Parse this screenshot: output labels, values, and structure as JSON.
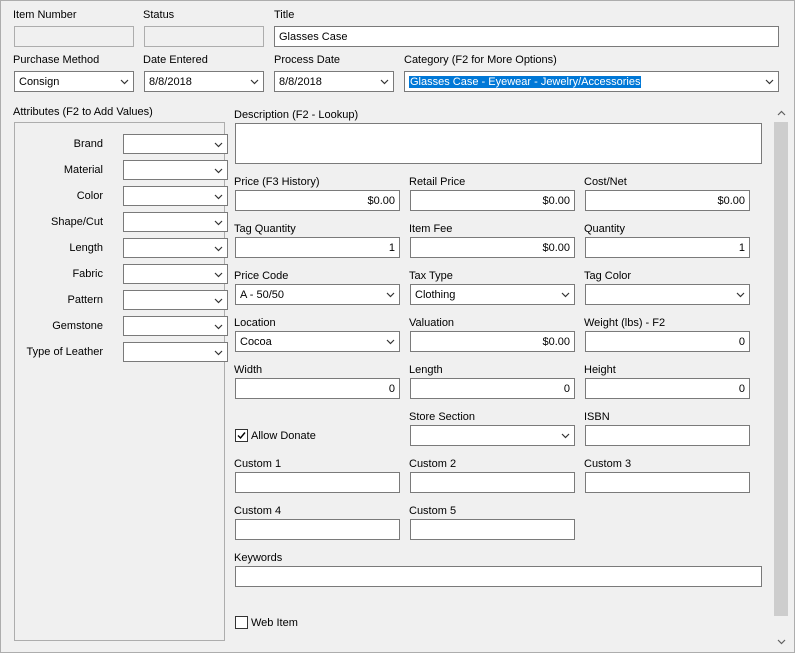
{
  "header": {
    "item_number": {
      "label": "Item Number",
      "value": ""
    },
    "status": {
      "label": "Status",
      "value": ""
    },
    "title": {
      "label": "Title",
      "value": "Glasses Case"
    },
    "purchase_method": {
      "label": "Purchase Method",
      "value": "Consign"
    },
    "date_entered": {
      "label": "Date Entered",
      "value": "8/8/2018"
    },
    "process_date": {
      "label": "Process Date",
      "value": "8/8/2018"
    },
    "category": {
      "label": "Category (F2 for More Options)",
      "value": "Glasses Case - Eyewear - Jewelry/Accessories"
    }
  },
  "attributes": {
    "title": "Attributes (F2 to Add Values)",
    "items": [
      {
        "label": "Brand",
        "value": ""
      },
      {
        "label": "Material",
        "value": ""
      },
      {
        "label": "Color",
        "value": ""
      },
      {
        "label": "Shape/Cut",
        "value": ""
      },
      {
        "label": "Length",
        "value": ""
      },
      {
        "label": "Fabric",
        "value": ""
      },
      {
        "label": "Pattern",
        "value": ""
      },
      {
        "label": "Gemstone",
        "value": ""
      },
      {
        "label": "Type of Leather",
        "value": ""
      }
    ]
  },
  "details": {
    "description": {
      "label": "Description (F2 - Lookup)",
      "value": ""
    },
    "price": {
      "label": "Price (F3 History)",
      "value": "$0.00"
    },
    "retail_price": {
      "label": "Retail Price",
      "value": "$0.00"
    },
    "cost_net": {
      "label": "Cost/Net",
      "value": "$0.00"
    },
    "tag_quantity": {
      "label": "Tag Quantity",
      "value": "1"
    },
    "item_fee": {
      "label": "Item Fee",
      "value": "$0.00"
    },
    "quantity": {
      "label": "Quantity",
      "value": "1"
    },
    "price_code": {
      "label": "Price Code",
      "value": "A - 50/50"
    },
    "tax_type": {
      "label": "Tax Type",
      "value": "Clothing"
    },
    "tag_color": {
      "label": "Tag Color",
      "value": ""
    },
    "location": {
      "label": "Location",
      "value": "Cocoa"
    },
    "valuation": {
      "label": "Valuation",
      "value": "$0.00"
    },
    "weight": {
      "label": "Weight (lbs) - F2",
      "value": "0"
    },
    "width": {
      "label": "Width",
      "value": "0"
    },
    "length": {
      "label": "Length",
      "value": "0"
    },
    "height": {
      "label": "Height",
      "value": "0"
    },
    "allow_donate": {
      "label": "Allow Donate",
      "checked": true
    },
    "store_section": {
      "label": "Store Section",
      "value": ""
    },
    "isbn": {
      "label": "ISBN",
      "value": ""
    },
    "custom1": {
      "label": "Custom 1",
      "value": ""
    },
    "custom2": {
      "label": "Custom 2",
      "value": ""
    },
    "custom3": {
      "label": "Custom 3",
      "value": ""
    },
    "custom4": {
      "label": "Custom 4",
      "value": ""
    },
    "custom5": {
      "label": "Custom 5",
      "value": ""
    },
    "keywords": {
      "label": "Keywords",
      "value": ""
    },
    "web_item": {
      "label": "Web Item",
      "checked": false
    }
  },
  "colors": {
    "window_bg": "#f0f0f0",
    "selection": "#0078d7",
    "field_border": "#7a7a7a",
    "scroll_thumb": "#cdcdcd"
  },
  "icons": [
    "chevron-down-icon",
    "checkmark-icon",
    "scroll-up-arrow-icon",
    "scroll-down-arrow-icon"
  ]
}
